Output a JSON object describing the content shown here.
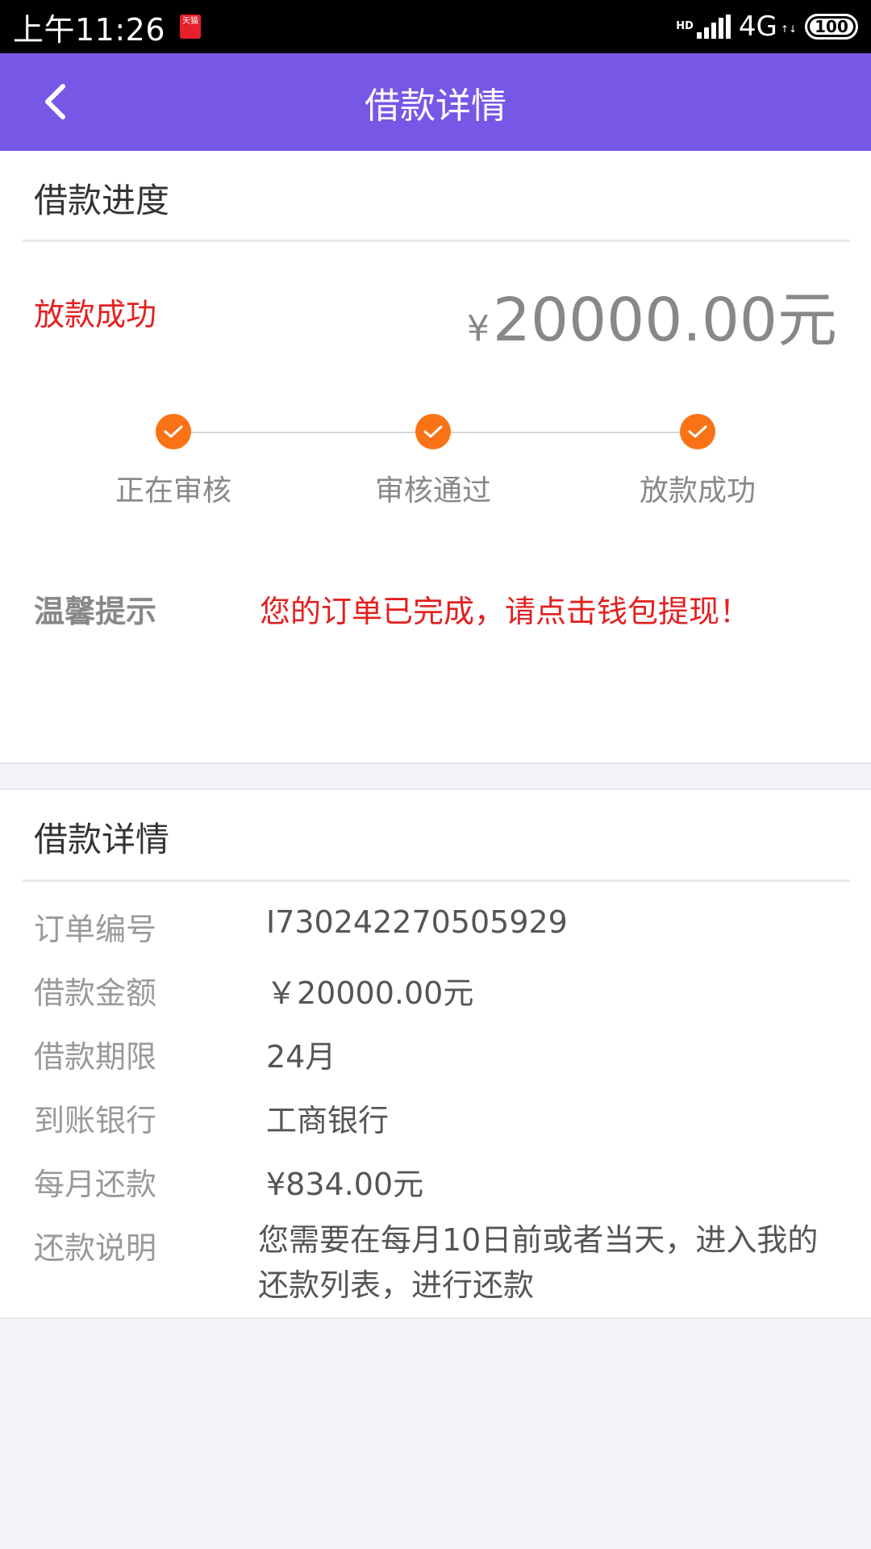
{
  "status_bar": {
    "time": "上午11:26",
    "app_notification": "天猫",
    "hd": "HD",
    "network": "4G",
    "battery": "100"
  },
  "header": {
    "title": "借款详情"
  },
  "progress_section": {
    "title": "借款进度",
    "status": "放款成功",
    "currency_symbol": "¥",
    "amount": "20000.00元",
    "steps": [
      {
        "label": "正在审核",
        "completed": true
      },
      {
        "label": "审核通过",
        "completed": true
      },
      {
        "label": "放款成功",
        "completed": true
      }
    ],
    "tip_label": "温馨提示",
    "tip_text": "您的订单已完成，请点击钱包提现！"
  },
  "details_section": {
    "title": "借款详情",
    "rows": [
      {
        "label": "订单编号",
        "value": "I730242270505929"
      },
      {
        "label": "借款金额",
        "value": "￥20000.00元"
      },
      {
        "label": "借款期限",
        "value": "24月"
      },
      {
        "label": "到账银行",
        "value": "工商银行"
      },
      {
        "label": "每月还款",
        "value": "¥834.00元"
      },
      {
        "label": "还款说明",
        "value": "您需要在每月10日前或者当天，进入我的还款列表，进行还款"
      }
    ]
  },
  "colors": {
    "header_bg": "#7657e6",
    "accent_red": "#e32020",
    "step_orange": "#f97316"
  }
}
